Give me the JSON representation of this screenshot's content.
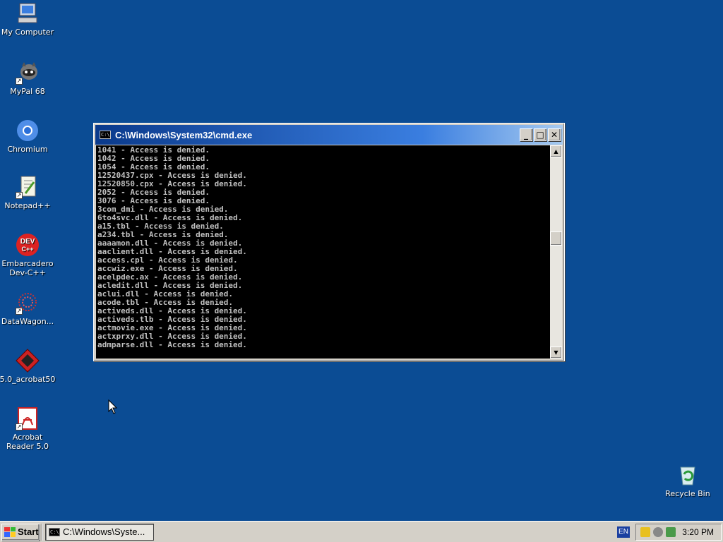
{
  "desktop": {
    "icons": [
      {
        "label": "My Computer"
      },
      {
        "label": "MyPal 68"
      },
      {
        "label": "Chromium"
      },
      {
        "label": "Notepad++"
      },
      {
        "label": "Embarcadero Dev-C++"
      },
      {
        "label": "DataWagon..."
      },
      {
        "label": "5.0_acrobat50"
      },
      {
        "label": "Acrobat Reader 5.0"
      },
      {
        "label": "Recycle Bin"
      }
    ]
  },
  "cmd_window": {
    "title": "C:\\Windows\\System32\\cmd.exe",
    "icon_glyph": "C:\\",
    "minimize": "_",
    "maximize": "□",
    "close": "✕",
    "lines": [
      "1041 - Access is denied.",
      "1042 - Access is denied.",
      "1054 - Access is denied.",
      "12520437.cpx - Access is denied.",
      "12520850.cpx - Access is denied.",
      "2052 - Access is denied.",
      "3076 - Access is denied.",
      "3com_dmi - Access is denied.",
      "6to4svc.dll - Access is denied.",
      "a15.tbl - Access is denied.",
      "a234.tbl - Access is denied.",
      "aaaamon.dll - Access is denied.",
      "aaclient.dll - Access is denied.",
      "access.cpl - Access is denied.",
      "accwiz.exe - Access is denied.",
      "acelpdec.ax - Access is denied.",
      "acledit.dll - Access is denied.",
      "aclui.dll - Access is denied.",
      "acode.tbl - Access is denied.",
      "activeds.dll - Access is denied.",
      "activeds.tlb - Access is denied.",
      "actmovie.exe - Access is denied.",
      "actxprxy.dll - Access is denied.",
      "admparse.dll - Access is denied."
    ],
    "scroll_up": "▲",
    "scroll_down": "▼"
  },
  "taskbar": {
    "start_label": "Start",
    "task_label": "C:\\Windows\\Syste...",
    "language": "EN",
    "clock": "3:20 PM"
  }
}
